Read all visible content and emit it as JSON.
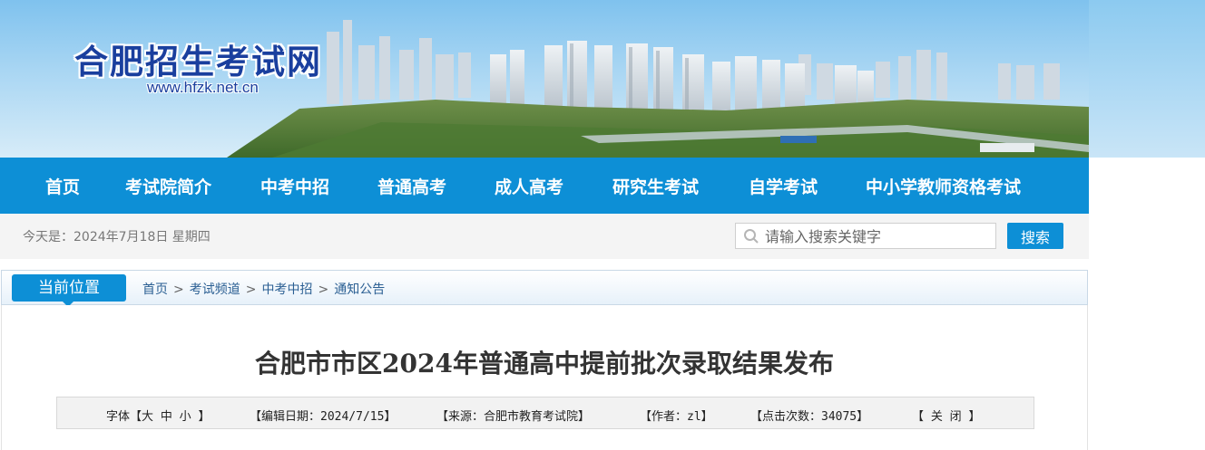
{
  "header": {
    "site_title": "合肥招生考试网",
    "site_url": "www.hfzk.net.cn"
  },
  "nav": {
    "items": [
      "首页",
      "考试院简介",
      "中考中招",
      "普通高考",
      "成人高考",
      "研究生考试",
      "自学考试",
      "中小学教师资格考试"
    ]
  },
  "infobar": {
    "date_text": "今天是：2024年7月18日 星期四",
    "search_placeholder": "请输入搜索关键字",
    "search_button": "搜索"
  },
  "breadcrumb": {
    "label": "当前位置",
    "items": [
      "首页",
      "考试频道",
      "中考中招",
      "通知公告"
    ],
    "separator": ">"
  },
  "article": {
    "title": "合肥市市区2024年普通高中提前批次录取结果发布",
    "meta": {
      "font_size": "字体【大 中 小 】",
      "edit_date": "【编辑日期：2024/7/15】",
      "source": "【来源：合肥市教育考试院】",
      "author": "【作者：zl】",
      "clicks": "【点击次数：34075】",
      "close": "【 关 闭 】"
    }
  },
  "colors": {
    "nav_blue": "#0d8fd6",
    "logo_blue": "#1a3f9e"
  }
}
